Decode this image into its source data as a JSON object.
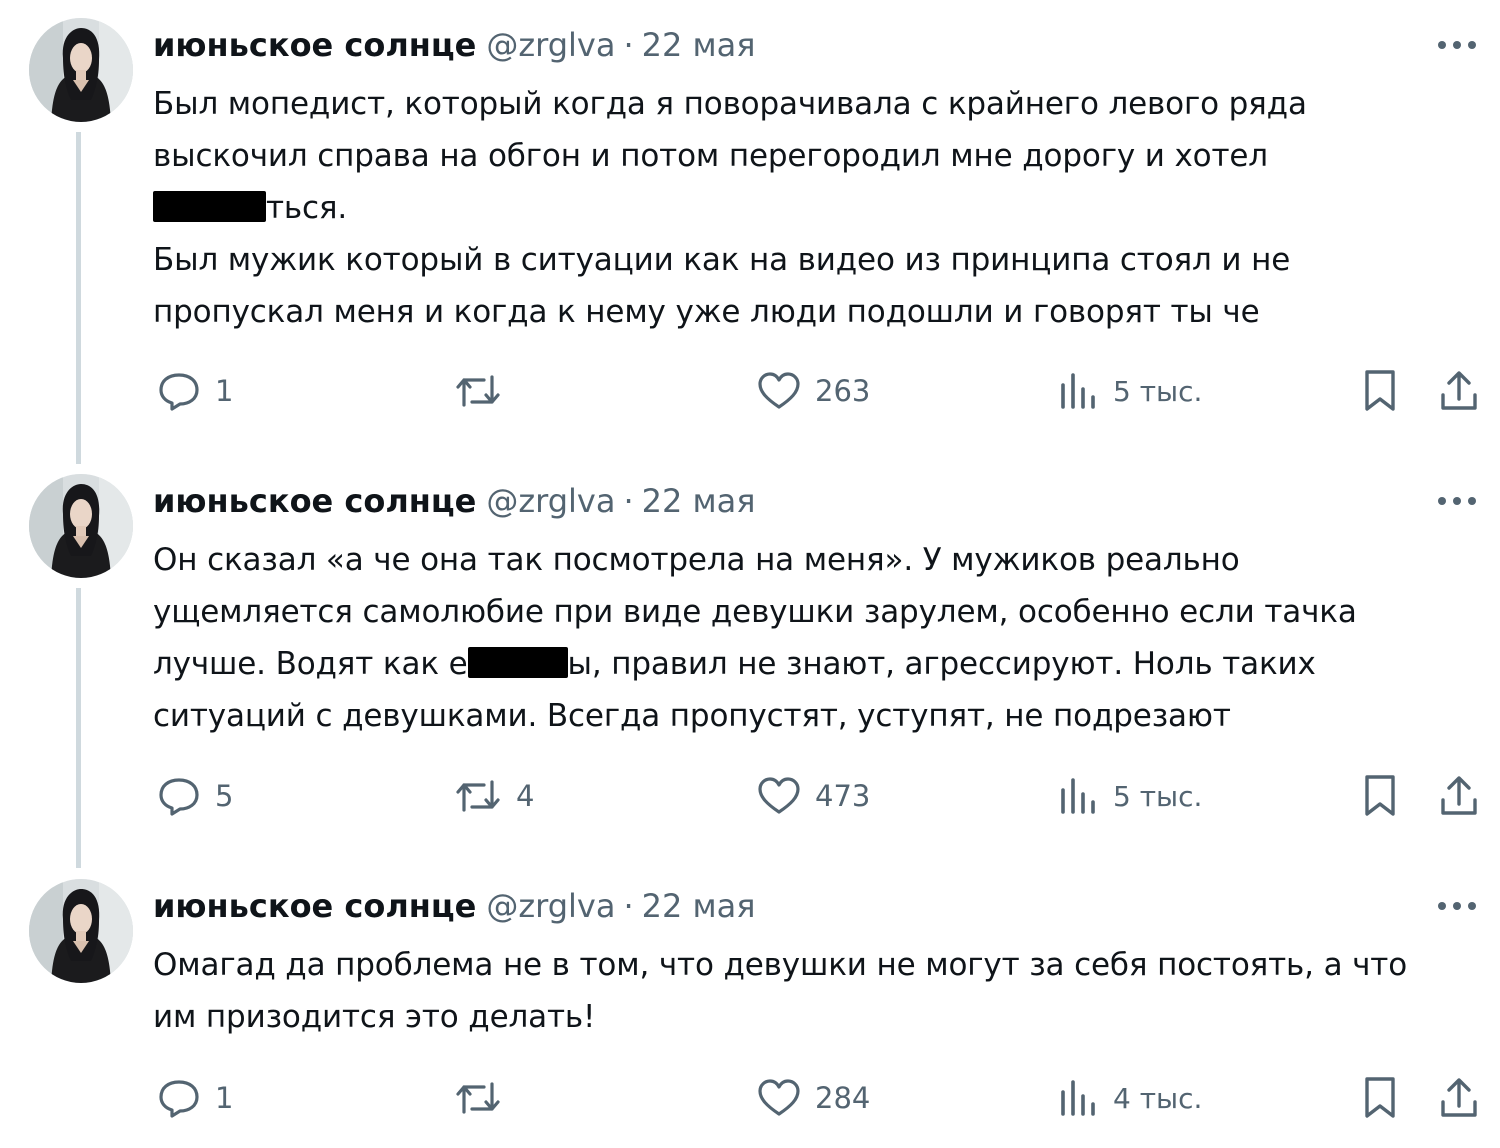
{
  "tweets": [
    {
      "author_name": "июньское солнце",
      "handle": "@zrglva",
      "separator": "·",
      "date": "22 мая",
      "lines": [
        "Был мопедист, который когда я поворачивала с крайнего левого ряда",
        "выскочил справа на обгон и потом перегородил мне дорогу и хотел",
        "ться.",
        "Был мужик который в ситуации как на видео из принципа стоял и не",
        "пропускал меня и когда к нему уже люди подошли и говорят ты че"
      ],
      "replies": "1",
      "reposts": "",
      "likes": "263",
      "views": "5 тыс."
    },
    {
      "author_name": "июньское солнце",
      "handle": "@zrglva",
      "separator": "·",
      "date": "22 мая",
      "lines": [
        "Он сказал «а че она так посмотрела на меня». У мужиков реально",
        "ущемляется самолюбие при виде девушки зарулем, особенно если тачка",
        "лучше. Водят как е",
        "ы, правил не знают, агрессируют. Ноль таких",
        "ситуаций с девушками. Всегда пропустят, уступят, не подрезают"
      ],
      "replies": "5",
      "reposts": "4",
      "likes": "473",
      "views": "5 тыс."
    },
    {
      "author_name": "июньское солнце",
      "handle": "@zrglva",
      "separator": "·",
      "date": "22 мая",
      "lines": [
        "Омагад да проблема не в том, что девушки не могут за себя постоять, а что",
        "им призодится это делать!"
      ],
      "replies": "1",
      "reposts": "",
      "likes": "284",
      "views": "4 тыс."
    }
  ],
  "colors": {
    "text": "#0f1419",
    "secondary": "#536471",
    "thread_line": "#cfd9de",
    "censor_bar": "#000000"
  },
  "icons": [
    "reply-icon",
    "repost-icon",
    "like-icon",
    "views-icon",
    "bookmark-icon",
    "share-icon",
    "more-icon"
  ]
}
